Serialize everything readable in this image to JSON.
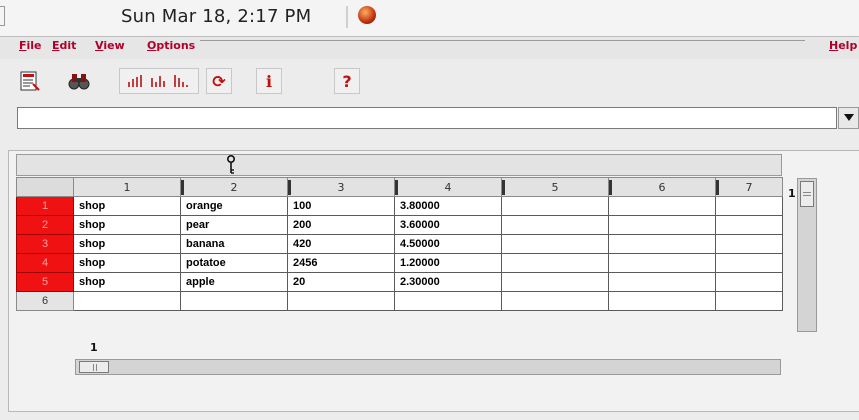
{
  "topbar": {
    "clock": "Sun Mar 18,  2:17 PM"
  },
  "menu": {
    "file": {
      "first": "F",
      "rest": "ile"
    },
    "edit": {
      "first": "E",
      "rest": "dit"
    },
    "view": {
      "first": "V",
      "rest": "iew"
    },
    "options": {
      "first": "O",
      "rest": "ptions"
    },
    "help": {
      "first": "H",
      "rest": "elp"
    }
  },
  "toolbar": {
    "icons": [
      "document-icon",
      "binoculars-icon",
      "chart-icon",
      "refresh-icon",
      "info-icon",
      "help-icon"
    ],
    "info_glyph": "i",
    "help_glyph": "?",
    "refresh_glyph": "⟳"
  },
  "query": {
    "value": ""
  },
  "sheet": {
    "columns": [
      "1",
      "2",
      "3",
      "4",
      "5",
      "6",
      "7"
    ],
    "row_labels": [
      "1",
      "2",
      "3",
      "4",
      "5",
      "6"
    ],
    "rows": [
      [
        "shop",
        "orange",
        "100",
        "3.80000",
        "",
        "",
        ""
      ],
      [
        "shop",
        "pear",
        "200",
        "3.60000",
        "",
        "",
        ""
      ],
      [
        "shop",
        "banana",
        "420",
        "4.50000",
        "",
        "",
        ""
      ],
      [
        "shop",
        "potatoe",
        "2456",
        "1.20000",
        "",
        "",
        ""
      ],
      [
        "shop",
        "apple",
        "20",
        "2.30000",
        "",
        "",
        ""
      ],
      [
        "",
        "",
        "",
        "",
        "",
        "",
        ""
      ]
    ]
  },
  "scroll": {
    "vertical_position": "1",
    "horizontal_position": "1"
  },
  "colors": {
    "selected_row": "#f01212",
    "menu_text": "#b0002a"
  }
}
